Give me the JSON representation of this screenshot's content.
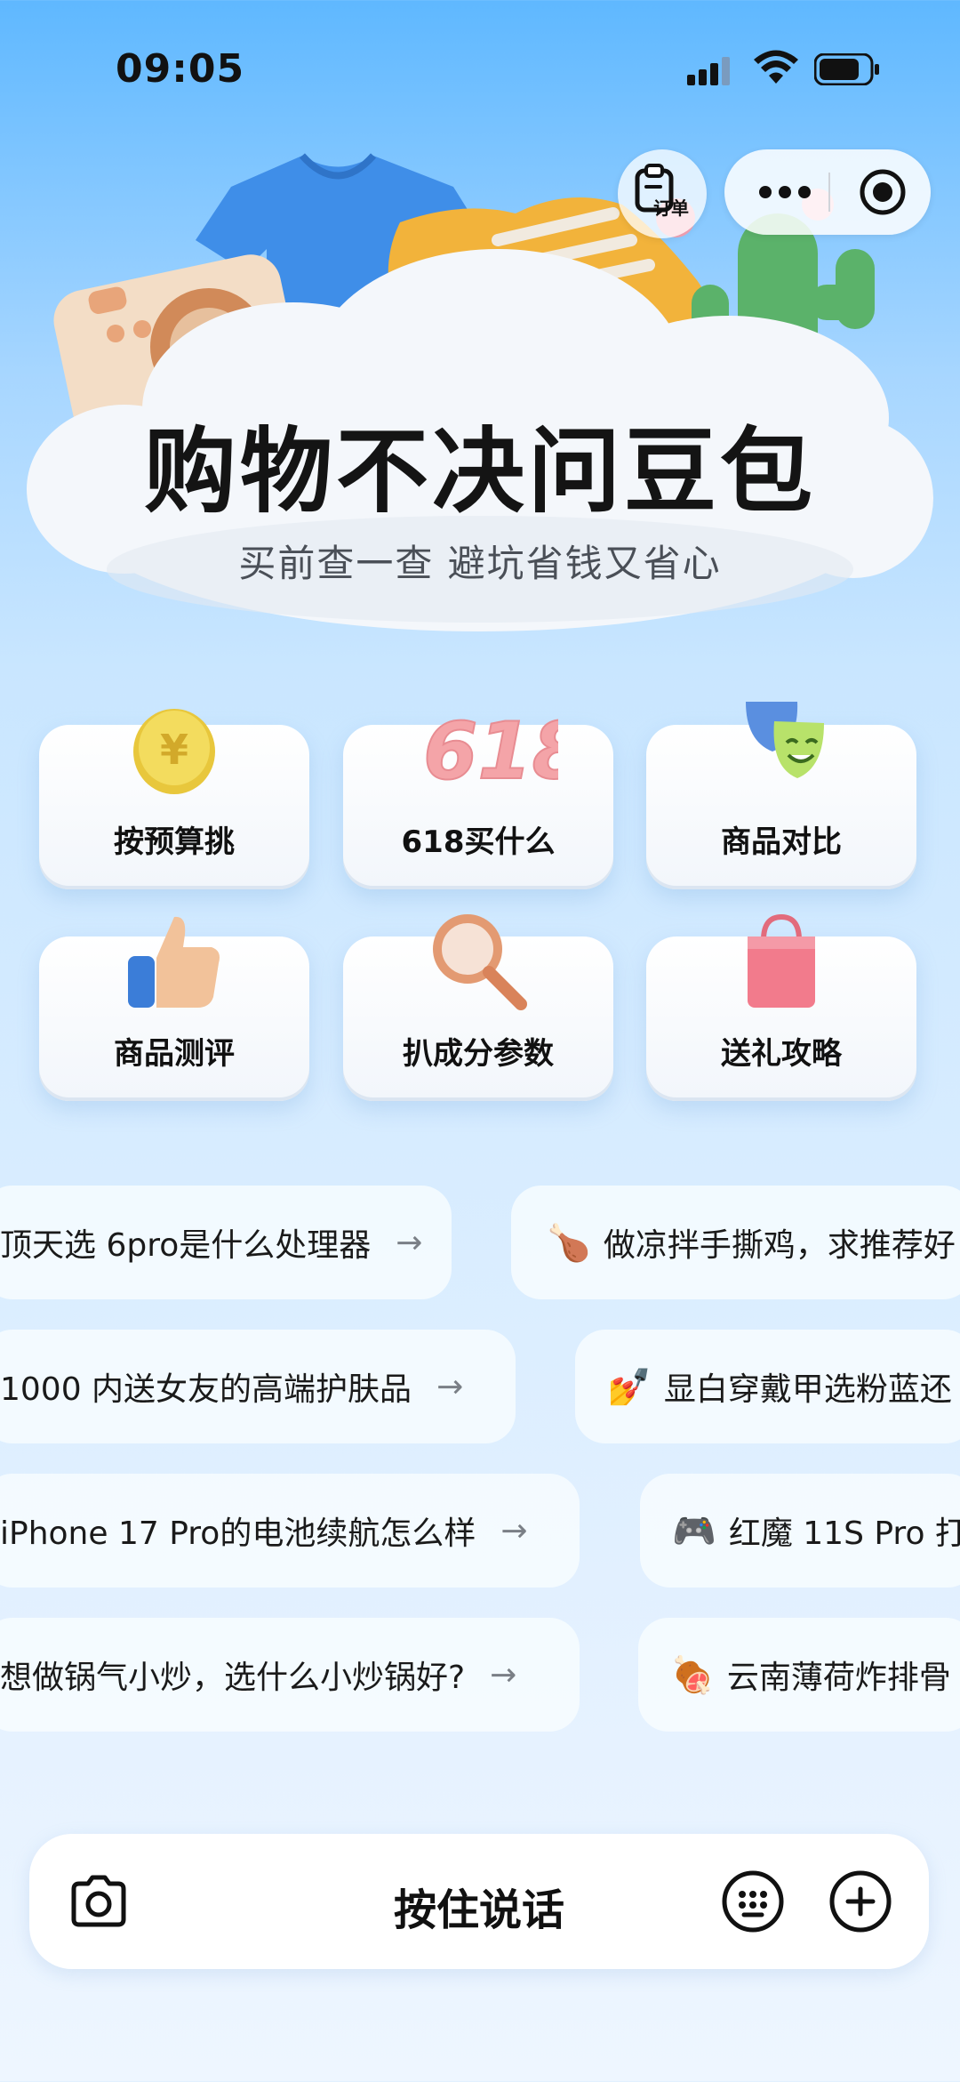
{
  "status_bar": {
    "time": "09:05"
  },
  "header": {
    "order_label": "订单"
  },
  "hero": {
    "title": "购物不决问豆包",
    "subtitle": "买前查一查 避坑省钱又省心"
  },
  "features": [
    {
      "label": "按预算挑",
      "icon": "yen-coin-icon"
    },
    {
      "label": "618买什么",
      "icon": "618-badge-icon"
    },
    {
      "label": "商品对比",
      "icon": "masks-icon"
    },
    {
      "label": "商品测评",
      "icon": "thumbs-up-icon"
    },
    {
      "label": "扒成分参数",
      "icon": "magnifier-icon"
    },
    {
      "label": "送礼攻略",
      "icon": "gift-bag-icon"
    }
  ],
  "suggestions": [
    {
      "text": "顶天选 6pro是什么处理器",
      "emoji": ""
    },
    {
      "text": "做凉拌手撕鸡，求推荐好",
      "emoji": "🍗"
    },
    {
      "text": "1000 内送女友的高端护肤品",
      "emoji": ""
    },
    {
      "text": "显白穿戴甲选粉蓝还",
      "emoji": "💅"
    },
    {
      "text": "iPhone 17 Pro的电池续航怎么样",
      "emoji": ""
    },
    {
      "text": "红魔 11S Pro 打",
      "emoji": "🎮"
    },
    {
      "text": "想做锅气小炒，选什么小炒锅好?",
      "emoji": ""
    },
    {
      "text": "云南薄荷炸排骨",
      "emoji": "🍖"
    }
  ],
  "input_bar": {
    "hold_to_talk": "按住说话"
  }
}
